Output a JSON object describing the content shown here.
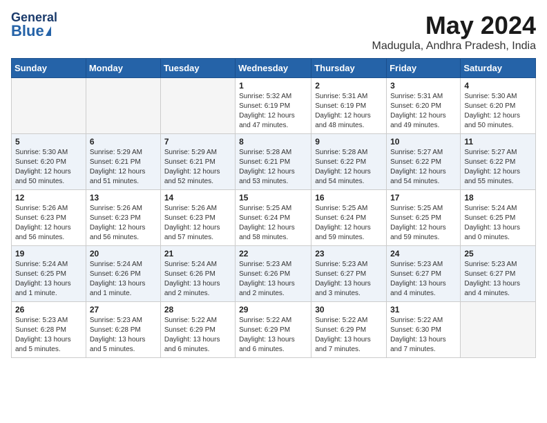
{
  "logo": {
    "general": "General",
    "blue": "Blue"
  },
  "title": {
    "month_year": "May 2024",
    "location": "Madugula, Andhra Pradesh, India"
  },
  "weekdays": [
    "Sunday",
    "Monday",
    "Tuesday",
    "Wednesday",
    "Thursday",
    "Friday",
    "Saturday"
  ],
  "weeks": [
    [
      {
        "date": "",
        "info": ""
      },
      {
        "date": "",
        "info": ""
      },
      {
        "date": "",
        "info": ""
      },
      {
        "date": "1",
        "info": "Sunrise: 5:32 AM\nSunset: 6:19 PM\nDaylight: 12 hours\nand 47 minutes."
      },
      {
        "date": "2",
        "info": "Sunrise: 5:31 AM\nSunset: 6:19 PM\nDaylight: 12 hours\nand 48 minutes."
      },
      {
        "date": "3",
        "info": "Sunrise: 5:31 AM\nSunset: 6:20 PM\nDaylight: 12 hours\nand 49 minutes."
      },
      {
        "date": "4",
        "info": "Sunrise: 5:30 AM\nSunset: 6:20 PM\nDaylight: 12 hours\nand 50 minutes."
      }
    ],
    [
      {
        "date": "5",
        "info": "Sunrise: 5:30 AM\nSunset: 6:20 PM\nDaylight: 12 hours\nand 50 minutes."
      },
      {
        "date": "6",
        "info": "Sunrise: 5:29 AM\nSunset: 6:21 PM\nDaylight: 12 hours\nand 51 minutes."
      },
      {
        "date": "7",
        "info": "Sunrise: 5:29 AM\nSunset: 6:21 PM\nDaylight: 12 hours\nand 52 minutes."
      },
      {
        "date": "8",
        "info": "Sunrise: 5:28 AM\nSunset: 6:21 PM\nDaylight: 12 hours\nand 53 minutes."
      },
      {
        "date": "9",
        "info": "Sunrise: 5:28 AM\nSunset: 6:22 PM\nDaylight: 12 hours\nand 54 minutes."
      },
      {
        "date": "10",
        "info": "Sunrise: 5:27 AM\nSunset: 6:22 PM\nDaylight: 12 hours\nand 54 minutes."
      },
      {
        "date": "11",
        "info": "Sunrise: 5:27 AM\nSunset: 6:22 PM\nDaylight: 12 hours\nand 55 minutes."
      }
    ],
    [
      {
        "date": "12",
        "info": "Sunrise: 5:26 AM\nSunset: 6:23 PM\nDaylight: 12 hours\nand 56 minutes."
      },
      {
        "date": "13",
        "info": "Sunrise: 5:26 AM\nSunset: 6:23 PM\nDaylight: 12 hours\nand 56 minutes."
      },
      {
        "date": "14",
        "info": "Sunrise: 5:26 AM\nSunset: 6:23 PM\nDaylight: 12 hours\nand 57 minutes."
      },
      {
        "date": "15",
        "info": "Sunrise: 5:25 AM\nSunset: 6:24 PM\nDaylight: 12 hours\nand 58 minutes."
      },
      {
        "date": "16",
        "info": "Sunrise: 5:25 AM\nSunset: 6:24 PM\nDaylight: 12 hours\nand 59 minutes."
      },
      {
        "date": "17",
        "info": "Sunrise: 5:25 AM\nSunset: 6:25 PM\nDaylight: 12 hours\nand 59 minutes."
      },
      {
        "date": "18",
        "info": "Sunrise: 5:24 AM\nSunset: 6:25 PM\nDaylight: 13 hours\nand 0 minutes."
      }
    ],
    [
      {
        "date": "19",
        "info": "Sunrise: 5:24 AM\nSunset: 6:25 PM\nDaylight: 13 hours\nand 1 minute."
      },
      {
        "date": "20",
        "info": "Sunrise: 5:24 AM\nSunset: 6:26 PM\nDaylight: 13 hours\nand 1 minute."
      },
      {
        "date": "21",
        "info": "Sunrise: 5:24 AM\nSunset: 6:26 PM\nDaylight: 13 hours\nand 2 minutes."
      },
      {
        "date": "22",
        "info": "Sunrise: 5:23 AM\nSunset: 6:26 PM\nDaylight: 13 hours\nand 2 minutes."
      },
      {
        "date": "23",
        "info": "Sunrise: 5:23 AM\nSunset: 6:27 PM\nDaylight: 13 hours\nand 3 minutes."
      },
      {
        "date": "24",
        "info": "Sunrise: 5:23 AM\nSunset: 6:27 PM\nDaylight: 13 hours\nand 4 minutes."
      },
      {
        "date": "25",
        "info": "Sunrise: 5:23 AM\nSunset: 6:27 PM\nDaylight: 13 hours\nand 4 minutes."
      }
    ],
    [
      {
        "date": "26",
        "info": "Sunrise: 5:23 AM\nSunset: 6:28 PM\nDaylight: 13 hours\nand 5 minutes."
      },
      {
        "date": "27",
        "info": "Sunrise: 5:23 AM\nSunset: 6:28 PM\nDaylight: 13 hours\nand 5 minutes."
      },
      {
        "date": "28",
        "info": "Sunrise: 5:22 AM\nSunset: 6:29 PM\nDaylight: 13 hours\nand 6 minutes."
      },
      {
        "date": "29",
        "info": "Sunrise: 5:22 AM\nSunset: 6:29 PM\nDaylight: 13 hours\nand 6 minutes."
      },
      {
        "date": "30",
        "info": "Sunrise: 5:22 AM\nSunset: 6:29 PM\nDaylight: 13 hours\nand 7 minutes."
      },
      {
        "date": "31",
        "info": "Sunrise: 5:22 AM\nSunset: 6:30 PM\nDaylight: 13 hours\nand 7 minutes."
      },
      {
        "date": "",
        "info": ""
      }
    ]
  ]
}
